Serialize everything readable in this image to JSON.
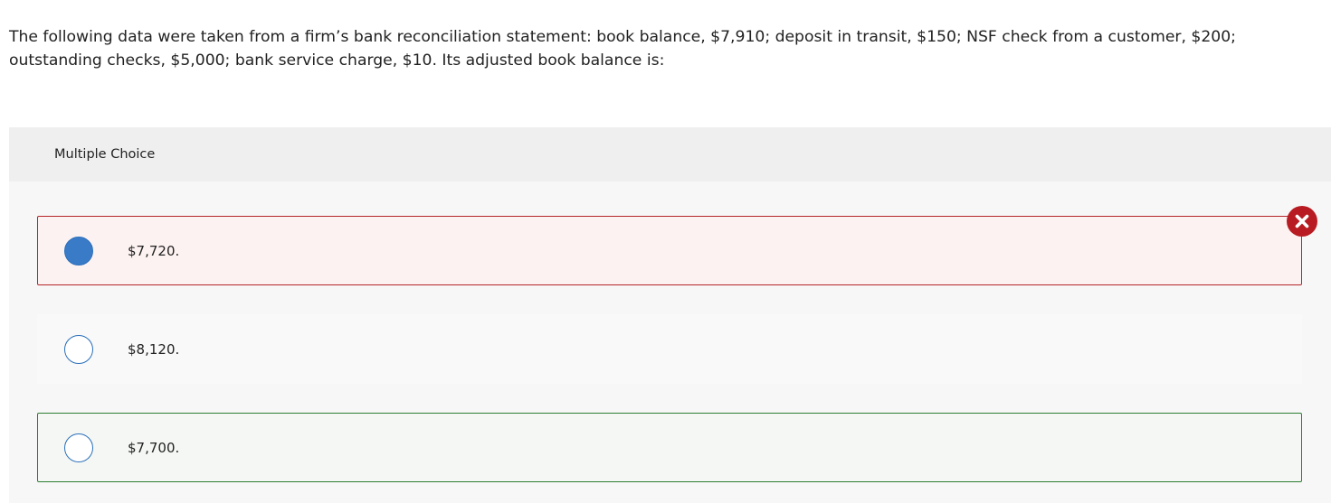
{
  "question": {
    "text": "The following data were taken from a firm’s bank reconciliation statement: book balance, $7,910; deposit in transit, $150; NSF check from a customer, $200; outstanding checks, $5,000; bank service charge, $10. Its adjusted book balance is:"
  },
  "panel": {
    "header_label": "Multiple Choice"
  },
  "options": [
    {
      "label": "$7,720.",
      "selected": true,
      "state": "incorrect"
    },
    {
      "label": "$8,120.",
      "selected": false,
      "state": "neutral"
    },
    {
      "label": "$7,700.",
      "selected": false,
      "state": "correct"
    }
  ],
  "icons": {
    "incorrect_marker": "close-icon"
  },
  "colors": {
    "incorrect_border": "#b3262a",
    "incorrect_background": "#fdf2f2",
    "correct_border": "#2e7d32",
    "radio_selected": "#3a7bc8",
    "incorrect_badge": "#b81c22"
  }
}
